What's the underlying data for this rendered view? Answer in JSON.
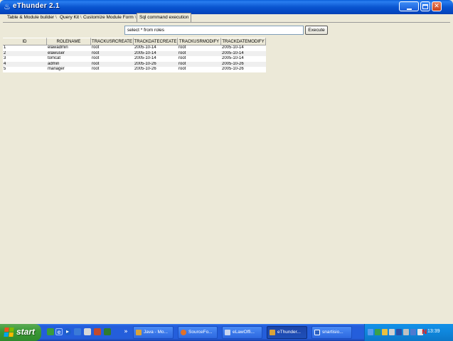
{
  "window": {
    "title": "eThunder 2.1",
    "minimize_label": "_",
    "maximize_label": "□",
    "close_label": "X"
  },
  "tabs": [
    {
      "label": "Table & Module builder"
    },
    {
      "label": "Query Kit"
    },
    {
      "label": "Customize Module Form"
    },
    {
      "label": "Sql command execution",
      "active": true
    }
  ],
  "sql": {
    "query": "select * from roles",
    "execute_label": "Execute"
  },
  "table": {
    "columns": [
      "ID",
      "ROLENAME",
      "TRACKUSRCREATE",
      "TRACKDATECREATE",
      "TRACKUSRMODIFY",
      "TRACKDATEMODIFY"
    ],
    "rows": [
      [
        "1",
        "elawadmin",
        "root",
        "2005-10-14",
        "root",
        "2005-10-14"
      ],
      [
        "2",
        "elawuser",
        "root",
        "2005-10-14",
        "root",
        "2005-10-14"
      ],
      [
        "3",
        "tomcat",
        "root",
        "2005-10-14",
        "root",
        "2005-10-14"
      ],
      [
        "4",
        "admin",
        "root",
        "2005-10-26",
        "root",
        "2005-10-26"
      ],
      [
        "5",
        "manager",
        "root",
        "2005-10-26",
        "root",
        "2005-10-26"
      ]
    ]
  },
  "taskbar": {
    "start_label": "start",
    "tasks": [
      {
        "label": "Java - Mo...",
        "icon": "java-icon"
      },
      {
        "label": "SourceFo...",
        "icon": "firefox-icon"
      },
      {
        "label": "eLawOffi...",
        "icon": "window-icon"
      },
      {
        "label": "eThunder...",
        "icon": "java-icon",
        "active": true
      },
      {
        "label": "snartisio...",
        "icon": "word-icon"
      }
    ],
    "clock": "13:39"
  },
  "colors": {
    "titlebar": "#0a55d0",
    "background": "#ece9d8",
    "taskbar": "#245edb",
    "start": "#3c9a36",
    "tray": "#0f86db"
  }
}
